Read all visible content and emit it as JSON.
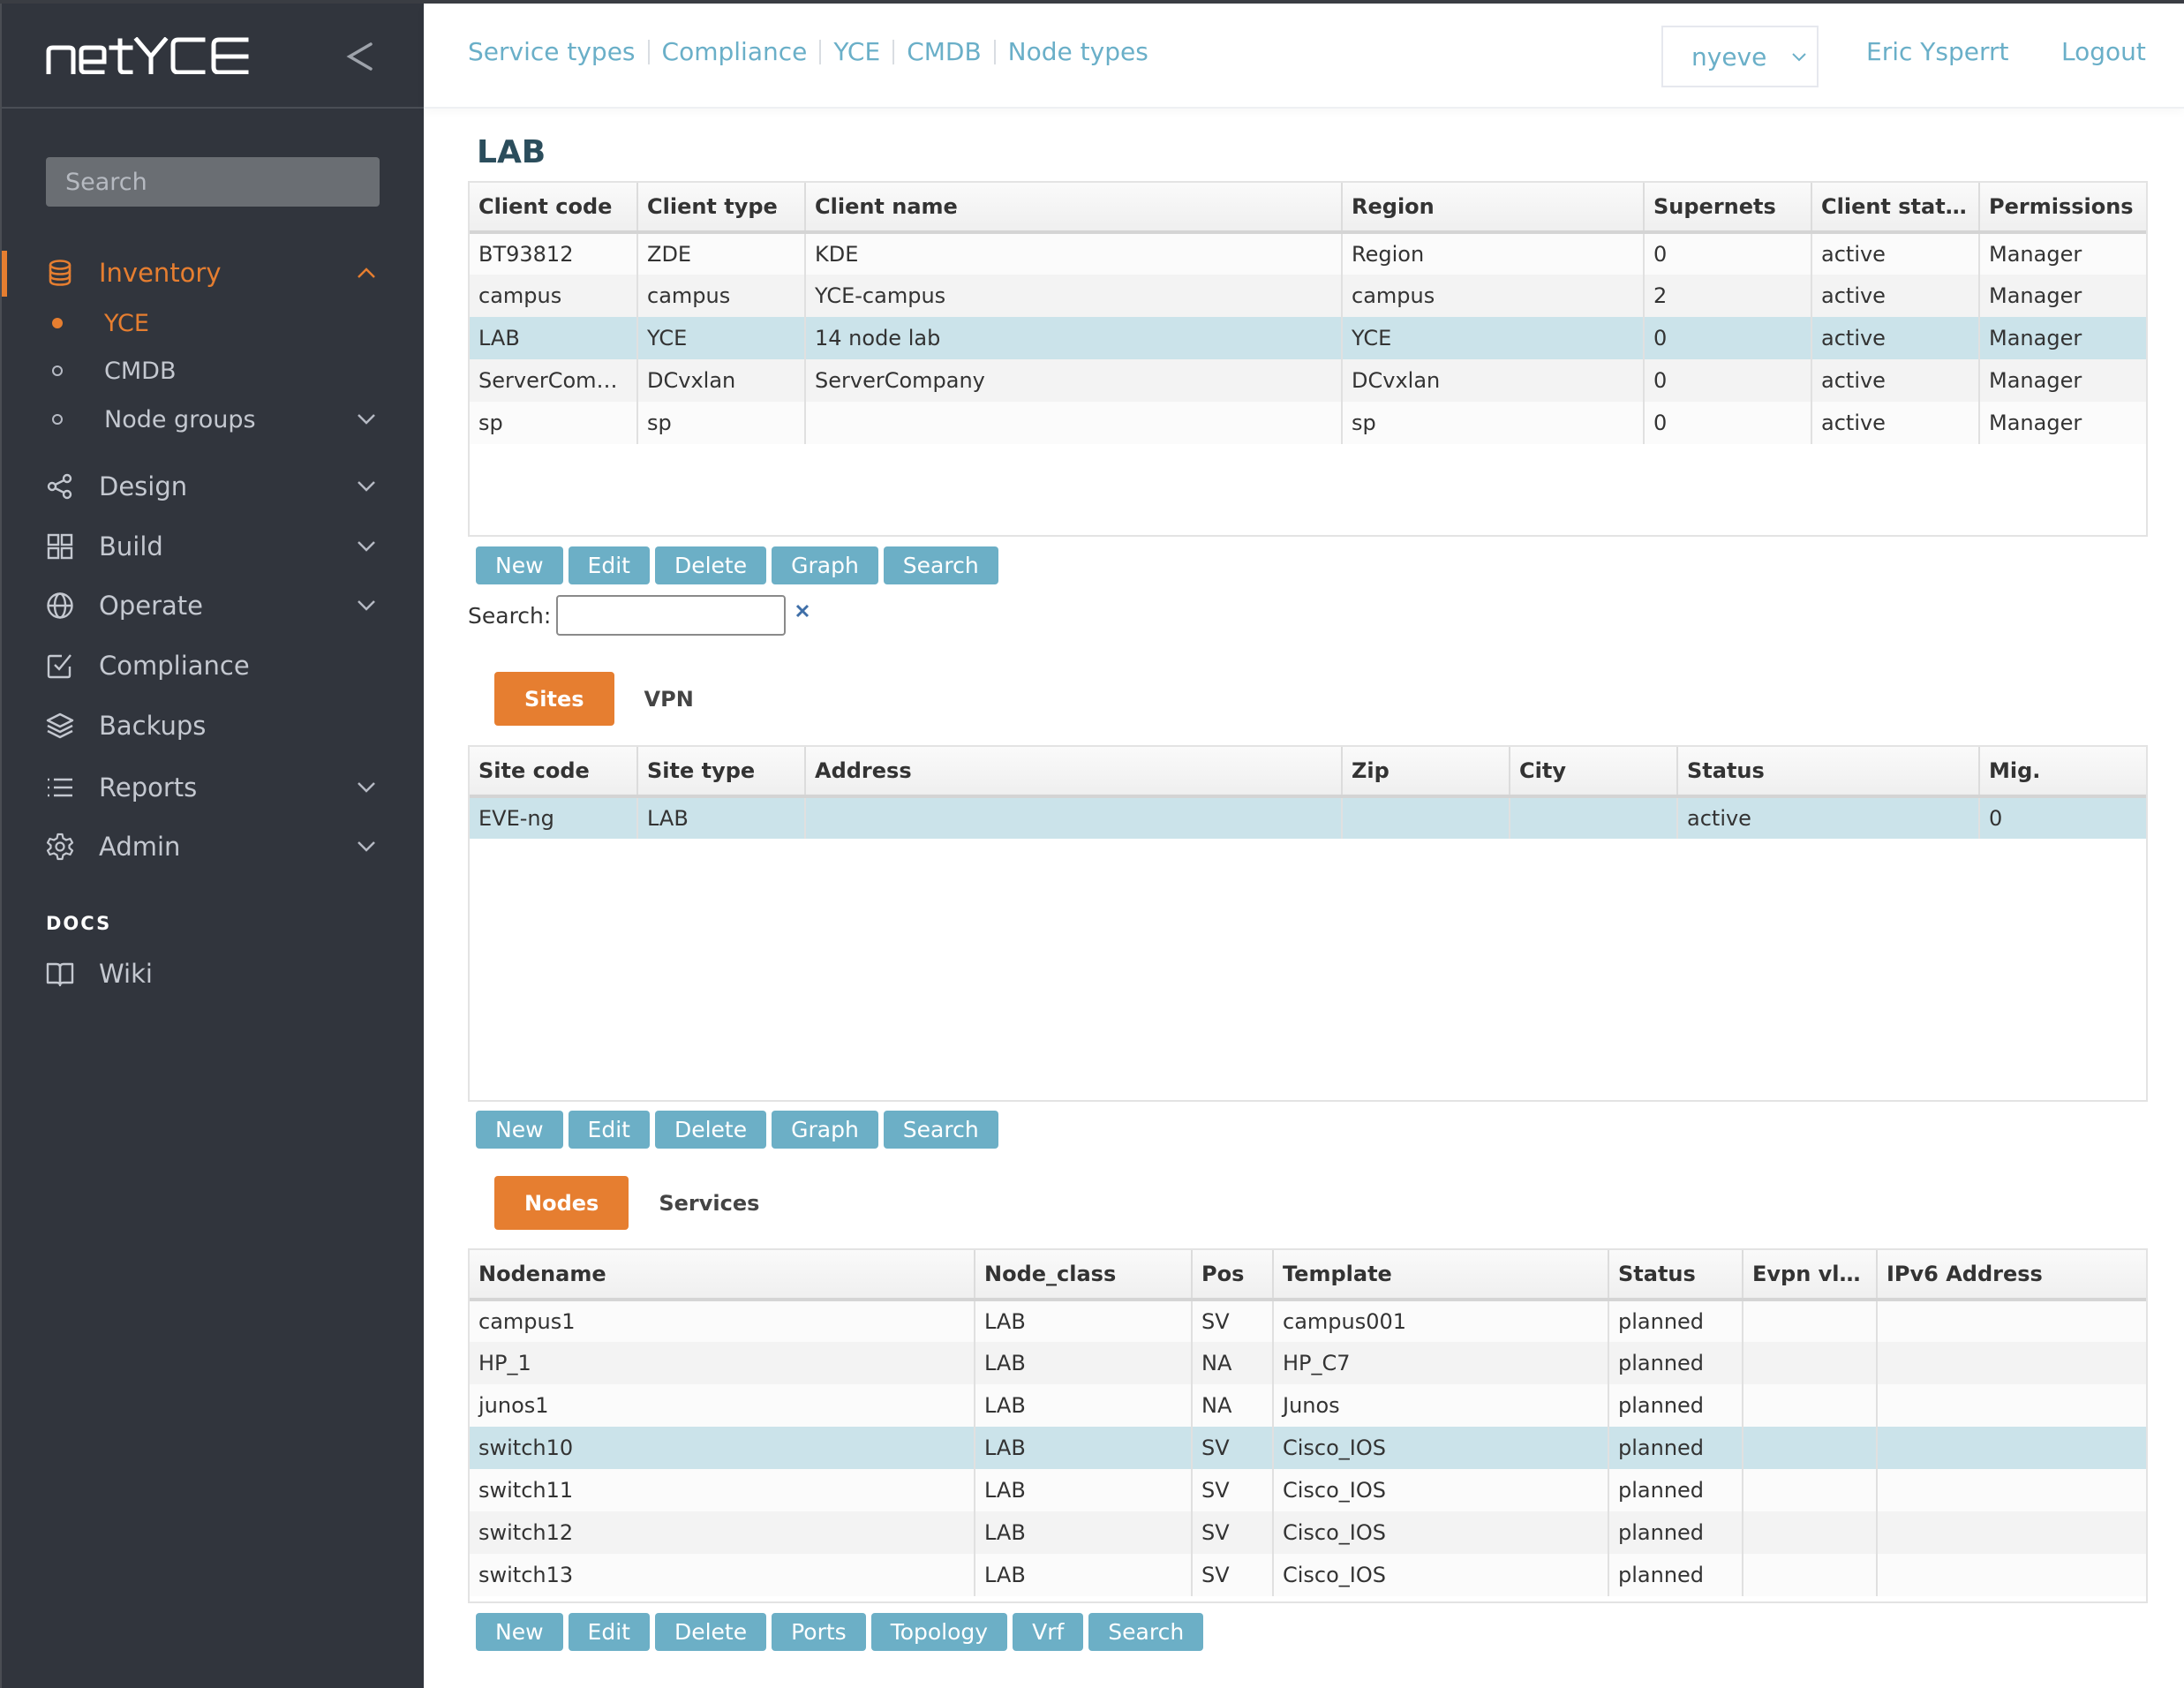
{
  "app": {
    "logo_text": "netYCE"
  },
  "sidebar": {
    "search_placeholder": "Search",
    "inventory": {
      "label": "Inventory",
      "icon": "database-icon",
      "expanded": true,
      "children": [
        {
          "label": "YCE",
          "active": true
        },
        {
          "label": "CMDB",
          "active": false
        },
        {
          "label": "Node groups",
          "active": false,
          "has_children": true
        }
      ]
    },
    "items": [
      {
        "label": "Design",
        "icon": "share-nodes-icon",
        "has_children": true
      },
      {
        "label": "Build",
        "icon": "grid-icon",
        "has_children": true
      },
      {
        "label": "Operate",
        "icon": "globe-icon",
        "has_children": true
      },
      {
        "label": "Compliance",
        "icon": "check-square-icon",
        "has_children": false
      },
      {
        "label": "Backups",
        "icon": "layers-icon",
        "has_children": false
      },
      {
        "label": "Reports",
        "icon": "list-icon",
        "has_children": true
      },
      {
        "label": "Admin",
        "icon": "gear-icon",
        "has_children": true
      }
    ],
    "docs_heading": "DOCS",
    "docs_items": [
      {
        "label": "Wiki",
        "icon": "book-icon"
      }
    ]
  },
  "header": {
    "nav_links": [
      "Service types",
      "Compliance",
      "YCE",
      "CMDB",
      "Node types"
    ],
    "environment": "nyeve",
    "user": "Eric Ysperrt",
    "logout": "Logout"
  },
  "page": {
    "title": "LAB"
  },
  "clients": {
    "columns": [
      "Client code",
      "Client type",
      "Client name",
      "Region",
      "Supernets",
      "Client statu...",
      "Permissions"
    ],
    "rows": [
      [
        "BT93812",
        "ZDE",
        "KDE",
        "Region",
        "0",
        "active",
        "Manager"
      ],
      [
        "campus",
        "campus",
        "YCE-campus",
        "campus",
        "2",
        "active",
        "Manager"
      ],
      [
        "LAB",
        "YCE",
        "14 node lab",
        "YCE",
        "0",
        "active",
        "Manager"
      ],
      [
        "ServerComp...",
        "DCvxlan",
        "ServerCompany",
        "DCvxlan",
        "0",
        "active",
        "Manager"
      ],
      [
        "sp",
        "sp",
        "",
        "sp",
        "0",
        "active",
        "Manager"
      ]
    ],
    "selected_row": 2,
    "buttons": [
      "New",
      "Edit",
      "Delete",
      "Graph",
      "Search"
    ],
    "search_label": "Search:",
    "search_value": ""
  },
  "site_tabs": [
    {
      "label": "Sites",
      "active": true
    },
    {
      "label": "VPN",
      "active": false
    }
  ],
  "sites": {
    "columns": [
      "Site code",
      "Site type",
      "Address",
      "Zip",
      "City",
      "Status",
      "Mig."
    ],
    "rows": [
      [
        "EVE-ng",
        "LAB",
        "",
        "",
        "",
        "active",
        "0"
      ]
    ],
    "selected_row": 0,
    "buttons": [
      "New",
      "Edit",
      "Delete",
      "Graph",
      "Search"
    ]
  },
  "node_tabs": [
    {
      "label": "Nodes",
      "active": true
    },
    {
      "label": "Services",
      "active": false
    }
  ],
  "nodes": {
    "columns": [
      "Nodename",
      "Node_class",
      "Pos",
      "Template",
      "Status",
      "Evpn vla...",
      "IPv6 Address"
    ],
    "rows": [
      [
        "campus1",
        "LAB",
        "SV",
        "campus001",
        "planned",
        "",
        ""
      ],
      [
        "HP_1",
        "LAB",
        "NA",
        "HP_C7",
        "planned",
        "",
        ""
      ],
      [
        "junos1",
        "LAB",
        "NA",
        "Junos",
        "planned",
        "",
        ""
      ],
      [
        "switch10",
        "LAB",
        "SV",
        "Cisco_IOS",
        "planned",
        "",
        ""
      ],
      [
        "switch11",
        "LAB",
        "SV",
        "Cisco_IOS",
        "planned",
        "",
        ""
      ],
      [
        "switch12",
        "LAB",
        "SV",
        "Cisco_IOS",
        "planned",
        "",
        ""
      ],
      [
        "switch13",
        "LAB",
        "SV",
        "Cisco_IOS",
        "planned",
        "",
        ""
      ]
    ],
    "selected_row": 3,
    "buttons": [
      "New",
      "Edit",
      "Delete",
      "Ports",
      "Topology",
      "Vrf",
      "Search"
    ]
  },
  "colors": {
    "accent": "#e67e30",
    "link": "#6aafc8",
    "button": "#6cafc6",
    "sidebar_bg": "#31353d",
    "selected_row": "#cbe3ea"
  }
}
